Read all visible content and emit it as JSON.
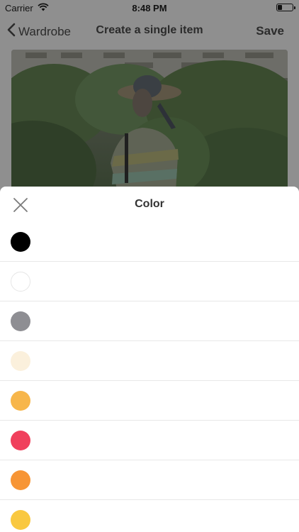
{
  "status_bar": {
    "carrier": "Carrier",
    "time": "8:48 PM"
  },
  "nav": {
    "back_label": "Wardrobe",
    "title": "Create a single item",
    "save_label": "Save"
  },
  "sheet": {
    "title": "Color",
    "colors": [
      {
        "name": "black",
        "hex": "#000000"
      },
      {
        "name": "white",
        "hex": "#FFFFFF"
      },
      {
        "name": "gray",
        "hex": "#8E8E93"
      },
      {
        "name": "cream",
        "hex": "#FBF0DC"
      },
      {
        "name": "light-orange",
        "hex": "#F7B64B"
      },
      {
        "name": "red",
        "hex": "#F0405C"
      },
      {
        "name": "orange",
        "hex": "#F79535"
      },
      {
        "name": "yellow",
        "hex": "#F9C840"
      }
    ]
  }
}
